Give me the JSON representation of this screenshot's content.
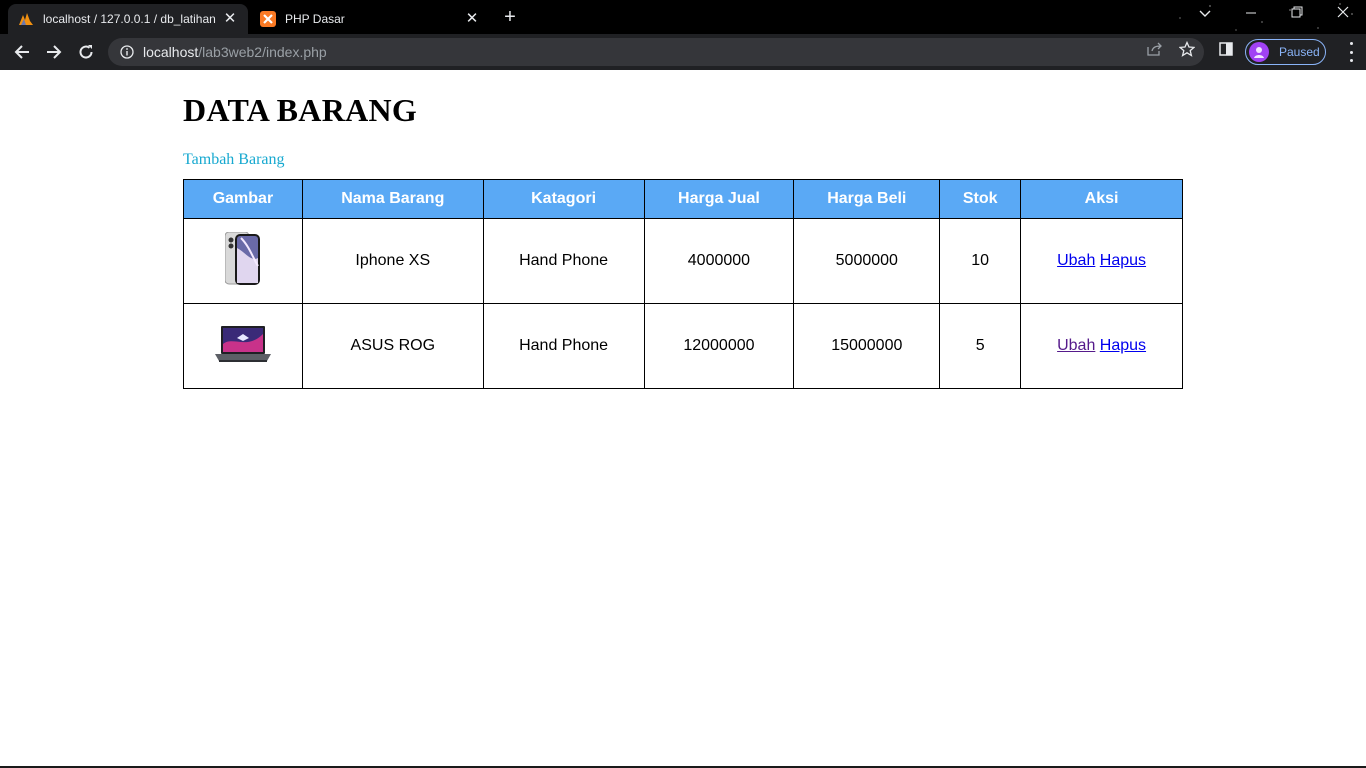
{
  "browser": {
    "tabs": [
      {
        "title": "localhost / 127.0.0.1 / db_latihan",
        "active": true,
        "favicon": "phpmyadmin-icon"
      },
      {
        "title": "PHP Dasar",
        "active": false,
        "favicon": "xampp-icon"
      }
    ],
    "url_host": "localhost",
    "url_path": "/lab3web2/index.php",
    "profile_label": "Paused"
  },
  "page": {
    "title": "DATA BARANG",
    "add_link": "Tambah Barang"
  },
  "table": {
    "headers": [
      "Gambar",
      "Nama Barang",
      "Katagori",
      "Harga Jual",
      "Harga Beli",
      "Stok",
      "Aksi"
    ],
    "rows": [
      {
        "image": "iphone-xs-image",
        "nama": "Iphone XS",
        "kategori": "Hand Phone",
        "harga_jual": "4000000",
        "harga_beli": "5000000",
        "stok": "10",
        "ubah": "Ubah",
        "hapus": "Hapus"
      },
      {
        "image": "asus-rog-laptop-image",
        "nama": "ASUS ROG",
        "kategori": "Hand Phone",
        "harga_jual": "12000000",
        "harga_beli": "15000000",
        "stok": "5",
        "ubah": "Ubah",
        "hapus": "Hapus"
      }
    ]
  },
  "colors": {
    "header_bg": "#5aa9f5",
    "add_link": "#17a9d0",
    "link": "#0000ee",
    "link_visited": "#551a8b"
  }
}
